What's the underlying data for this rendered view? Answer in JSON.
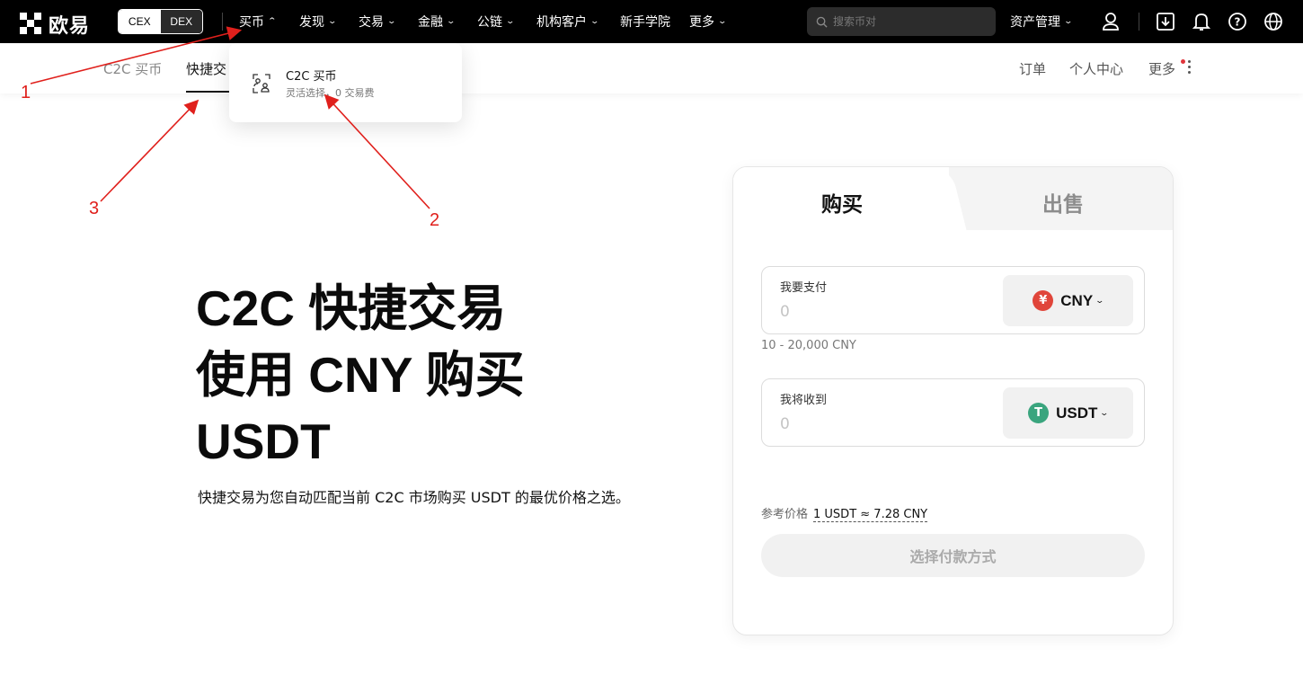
{
  "header": {
    "logo_text": "欧易",
    "mode_toggle": {
      "active": "CEX",
      "inactive": "DEX"
    },
    "nav": [
      {
        "label": "买币",
        "chevron": "up"
      },
      {
        "label": "发现",
        "chevron": "down"
      },
      {
        "label": "交易",
        "chevron": "down"
      },
      {
        "label": "金融",
        "chevron": "down"
      },
      {
        "label": "公链",
        "chevron": "down"
      },
      {
        "label": "机构客户",
        "chevron": "down"
      },
      {
        "label": "新手学院",
        "chevron": ""
      },
      {
        "label": "更多",
        "chevron": "down"
      }
    ],
    "search_placeholder": "搜索币对",
    "asset_management": "资产管理",
    "icons": [
      "user-icon",
      "download-icon",
      "bell-icon",
      "help-icon",
      "globe-icon"
    ]
  },
  "subnav": {
    "tabs": [
      {
        "label": "C2C 买币",
        "active": false
      },
      {
        "label": "快捷交",
        "active": true
      }
    ],
    "right_links": [
      "订单",
      "个人中心",
      "更多"
    ]
  },
  "dropdown": {
    "title": "C2C 买币",
    "subtitle": "灵活选择，0 交易费"
  },
  "hero": {
    "title_lines": [
      "C2C 快捷交易",
      "使用 CNY 购买",
      "USDT"
    ],
    "description": "快捷交易为您自动匹配当前 C2C 市场购买 USDT 的最优价格之选。"
  },
  "trade_card": {
    "tab_buy": "购买",
    "tab_sell": "出售",
    "pay": {
      "label": "我要支付",
      "placeholder": "0",
      "currency": "CNY",
      "currency_symbol": "¥",
      "color": "#e0453a"
    },
    "range": "10 - 20,000 CNY",
    "receive": {
      "label": "我将收到",
      "placeholder": "0",
      "currency": "USDT",
      "currency_symbol": "T",
      "color": "#3aa57e"
    },
    "ref_label": "参考价格",
    "ref_value": "1 USDT ≈ 7.28 CNY",
    "submit": "选择付款方式"
  },
  "annotations": [
    "1",
    "2",
    "3"
  ],
  "colors": {
    "annotation": "#e0201c",
    "topbar": "#000000"
  }
}
